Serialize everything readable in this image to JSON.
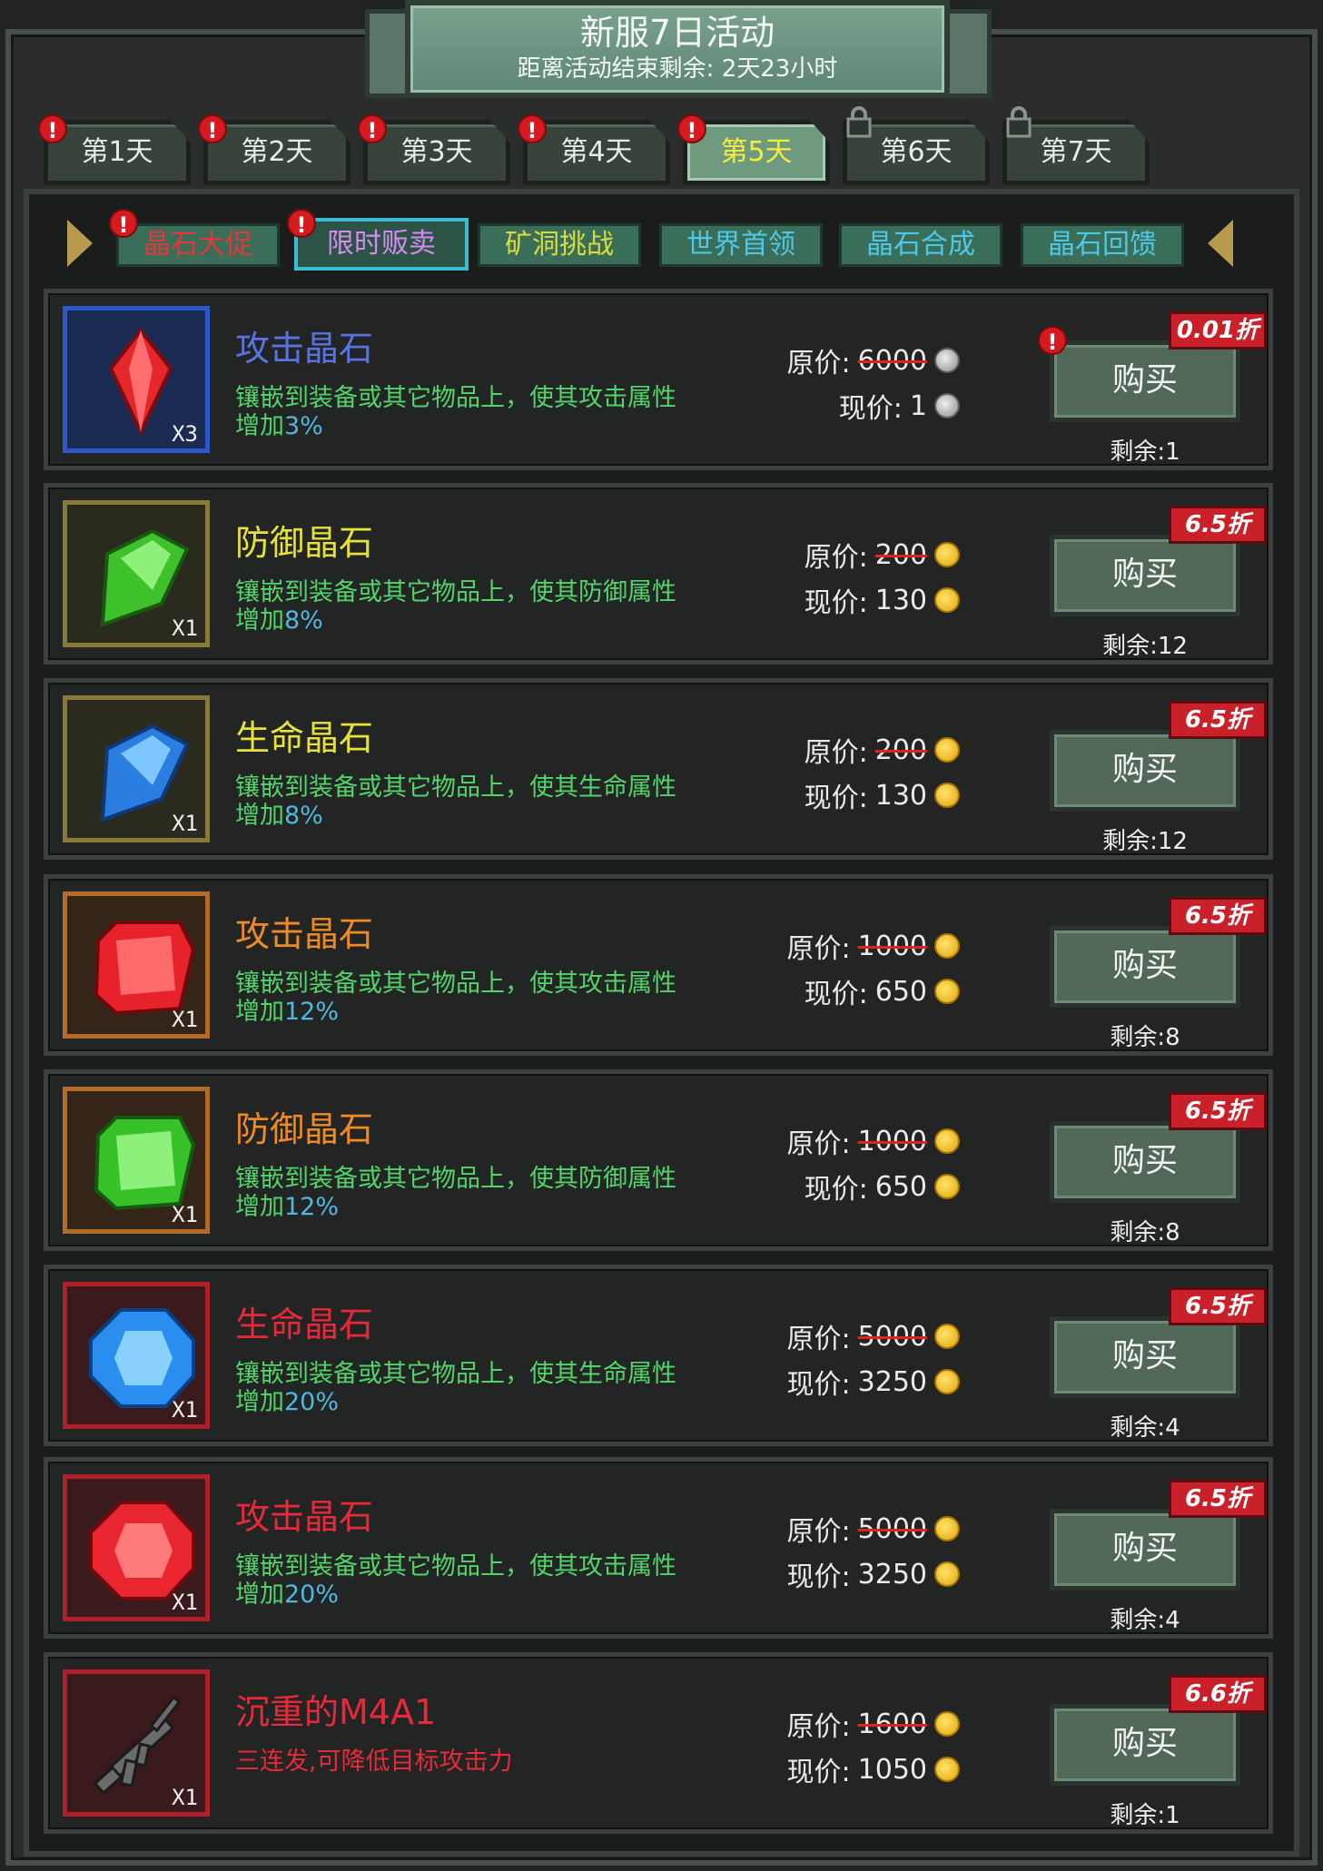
{
  "header": {
    "title": "新服7日活动",
    "subtitle": "距离活动结束剩余: 2天23小时"
  },
  "day_tabs": [
    {
      "label": "第1天",
      "alert": true,
      "locked": false
    },
    {
      "label": "第2天",
      "alert": true,
      "locked": false
    },
    {
      "label": "第3天",
      "alert": true,
      "locked": false
    },
    {
      "label": "第4天",
      "alert": true,
      "locked": false
    },
    {
      "label": "第5天",
      "alert": true,
      "locked": false,
      "active": true
    },
    {
      "label": "第6天",
      "alert": false,
      "locked": true
    },
    {
      "label": "第7天",
      "alert": false,
      "locked": true
    }
  ],
  "sub_tabs": [
    {
      "label": "晶石大促",
      "color": "#e5373b",
      "alert": true
    },
    {
      "label": "限时贩卖",
      "color": "#d88af2",
      "alert": true,
      "active": true
    },
    {
      "label": "矿洞挑战",
      "color": "#d8dc3c"
    },
    {
      "label": "世界首领",
      "color": "#4ec8e8"
    },
    {
      "label": "晶石合成",
      "color": "#4ec8e8"
    },
    {
      "label": "晶石回馈",
      "color": "#4ec8e8"
    }
  ],
  "labels": {
    "original": "原价:",
    "current": "现价:",
    "buy": "购买",
    "remain_prefix": "剩余:",
    "exclaim": "!"
  },
  "items": [
    {
      "name": "攻击晶石",
      "name_color": "#5a73e3",
      "desc": "镶嵌到装备或其它物品上，使其攻击属性",
      "desc2": "增加",
      "pct": "3%",
      "qty": "X3",
      "original": "6000",
      "current": "1",
      "coin": "silver",
      "discount": "0.01折",
      "remain": "剩余:1",
      "alert": true,
      "gem": "red-diamond",
      "frame": "#2a58c9",
      "bg": "#1a2a52"
    },
    {
      "name": "防御晶石",
      "name_color": "#e6e23a",
      "desc": "镶嵌到装备或其它物品上，使其防御属性",
      "desc2": "增加",
      "pct": "8%",
      "qty": "X1",
      "original": "200",
      "current": "130",
      "coin": "gold",
      "discount": "6.5折",
      "remain": "剩余:12",
      "gem": "green-kite",
      "frame": "#8a7a3a",
      "bg": "#2a2a1e"
    },
    {
      "name": "生命晶石",
      "name_color": "#e6e23a",
      "desc": "镶嵌到装备或其它物品上，使其生命属性",
      "desc2": "增加",
      "pct": "8%",
      "qty": "X1",
      "original": "200",
      "current": "130",
      "coin": "gold",
      "discount": "6.5折",
      "remain": "剩余:12",
      "gem": "blue-kite",
      "frame": "#8a7a3a",
      "bg": "#2a2a1e"
    },
    {
      "name": "攻击晶石",
      "name_color": "#ef8a25",
      "desc": "镶嵌到装备或其它物品上，使其攻击属性",
      "desc2": "增加",
      "pct": "12%",
      "qty": "X1",
      "original": "1000",
      "current": "650",
      "coin": "gold",
      "discount": "6.5折",
      "remain": "剩余:8",
      "gem": "red-rect",
      "frame": "#b46a28",
      "bg": "#352418"
    },
    {
      "name": "防御晶石",
      "name_color": "#ef8a25",
      "desc": "镶嵌到装备或其它物品上，使其防御属性",
      "desc2": "增加",
      "pct": "12%",
      "qty": "X1",
      "original": "1000",
      "current": "650",
      "coin": "gold",
      "discount": "6.5折",
      "remain": "剩余:8",
      "gem": "green-rect",
      "frame": "#b46a28",
      "bg": "#352418"
    },
    {
      "name": "生命晶石",
      "name_color": "#e8293a",
      "desc": "镶嵌到装备或其它物品上，使其生命属性",
      "desc2": "增加",
      "pct": "20%",
      "qty": "X1",
      "original": "5000",
      "current": "3250",
      "coin": "gold",
      "discount": "6.5折",
      "remain": "剩余:4",
      "gem": "blue-oct",
      "frame": "#b0202a",
      "bg": "#3a1a1c"
    },
    {
      "name": "攻击晶石",
      "name_color": "#e8293a",
      "desc": "镶嵌到装备或其它物品上，使其攻击属性",
      "desc2": "增加",
      "pct": "20%",
      "qty": "X1",
      "original": "5000",
      "current": "3250",
      "coin": "gold",
      "discount": "6.5折",
      "remain": "剩余:4",
      "gem": "red-oct",
      "frame": "#b0202a",
      "bg": "#3a1a1c"
    },
    {
      "name": "沉重的M4A1",
      "name_color": "#e8293a",
      "desc": "三连发,可降低目标攻击力",
      "desc_color": "#e8293a",
      "desc2": "",
      "pct": "",
      "qty": "X1",
      "original": "1600",
      "current": "1050",
      "coin": "gold",
      "discount": "6.6折",
      "remain": "剩余:1",
      "gem": "rifle",
      "frame": "#b0202a",
      "bg": "#3a1a1c"
    }
  ]
}
